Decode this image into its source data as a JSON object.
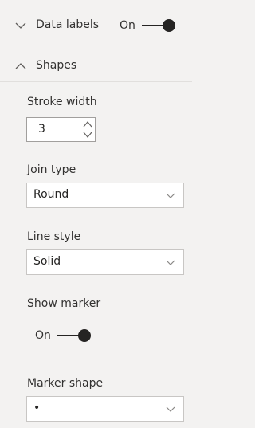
{
  "data_labels": {
    "header": "Data labels",
    "toggle_label": "On",
    "toggle_on": true
  },
  "shapes": {
    "header": "Shapes",
    "stroke_width": {
      "label": "Stroke width",
      "value": "3"
    },
    "join_type": {
      "label": "Join type",
      "value": "Round"
    },
    "line_style": {
      "label": "Line style",
      "value": "Solid"
    },
    "show_marker": {
      "label": "Show marker",
      "toggle_label": "On",
      "toggle_on": true
    },
    "marker_shape": {
      "label": "Marker shape",
      "value": "•"
    }
  },
  "icons": {
    "data_labels_chevron": "chevron-down-icon",
    "shapes_chevron": "chevron-up-icon",
    "stepper_up": "caret-up-icon",
    "stepper_down": "caret-down-icon",
    "dropdown_chevron": "chevron-down-icon"
  },
  "colors": {
    "panel_bg": "#f3f2f1",
    "text": "#252423",
    "border": "#c8c6c4",
    "toggle": "#252423"
  }
}
